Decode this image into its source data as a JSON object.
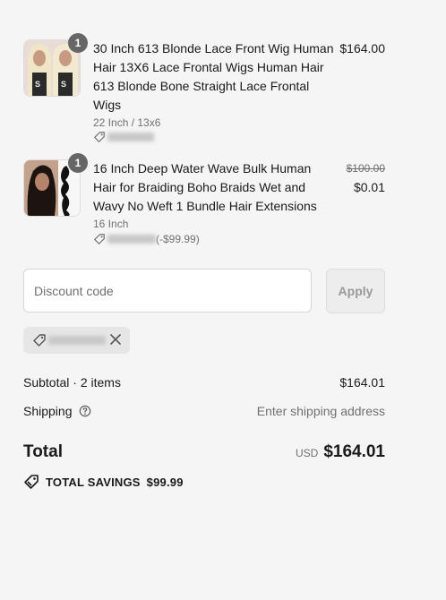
{
  "items": [
    {
      "title": "30 Inch 613 Blonde Lace Front Wig Human Hair 13X6 Lace Frontal Wigs Human Hair 613 Blonde Bone Straight Lace Frontal Wigs",
      "quantity": "1",
      "variant": "22 Inch / 13x6",
      "price": "$164.00",
      "discount_amount": ""
    },
    {
      "title": "16 Inch Deep Water Wave Bulk Human Hair for Braiding Boho Braids Wet and Wavy No Weft 1 Bundle Hair Extensions",
      "quantity": "1",
      "variant": "16 Inch",
      "original_price": "$100.00",
      "price": "$0.01",
      "discount_amount": "(-$99.99)"
    }
  ],
  "discount": {
    "placeholder": "Discount code",
    "apply_label": "Apply"
  },
  "summary": {
    "subtotal_label": "Subtotal · 2 items",
    "subtotal_value": "$164.01",
    "shipping_label": "Shipping",
    "shipping_value": "Enter shipping address",
    "total_label": "Total",
    "currency": "USD",
    "total_value": "$164.01",
    "savings_label": "TOTAL SAVINGS",
    "savings_value": "$99.99"
  },
  "icons": {
    "tag": "tag-icon",
    "help": "help-circle-icon",
    "close": "close-icon",
    "savings": "tag-icon"
  }
}
